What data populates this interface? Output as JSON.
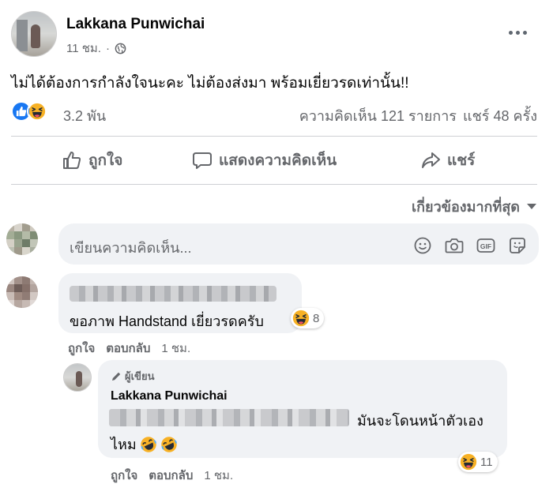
{
  "post": {
    "author": "Lakkana Punwichai",
    "time": "11 ชม.",
    "text": "ไม่ได้ต้องการกำลังใจนะคะ ไม่ต้องส่งมา พร้อมเยี่ยวรดเท่านั้น!!",
    "reaction_count": "3.2 พัน",
    "comments_count": "ความคิดเห็น 121 รายการ",
    "shares_count": "แชร์ 48 ครั้ง"
  },
  "actions": {
    "like": "ถูกใจ",
    "comment": "แสดงความคิดเห็น",
    "share": "แชร์"
  },
  "sort_label": "เกี่ยวข้องมากที่สุด",
  "composer": {
    "placeholder": "เขียนความคิดเห็น..."
  },
  "comments": [
    {
      "text": "ขอภาพ Handstand เยี่ยวรดครับ",
      "reaction_count": "8",
      "like_label": "ถูกใจ",
      "reply_label": "ตอบกลับ",
      "time": "1 ชม."
    }
  ],
  "reply": {
    "badge": "ผู้เขียน",
    "author": "Lakkana Punwichai",
    "text_line1": "มันจะโดนหน้าตัวเอง",
    "text_line2": "ไหม",
    "reaction_count": "11",
    "like_label": "ถูกใจ",
    "reply_label": "ตอบกลับ",
    "time": "1 ชม."
  },
  "icons": {
    "privacy": "globe-icon",
    "more": "more-icon",
    "like_reaction": "like-reaction-icon",
    "haha_reaction": "haha-reaction-icon",
    "like_action": "thumbs-up-icon",
    "comment_action": "speech-bubble-icon",
    "share_action": "share-arrow-icon",
    "sort": "chevron-down-icon",
    "emoji": "emoji-icon",
    "camera": "camera-icon",
    "gif": "gif-icon",
    "sticker": "sticker-icon",
    "pencil": "pencil-icon"
  },
  "colors": {
    "brand_blue": "#1877f2",
    "secondary_text": "#65676b",
    "bubble_bg": "#f0f2f5",
    "haha_yellow": "#f7b125"
  }
}
